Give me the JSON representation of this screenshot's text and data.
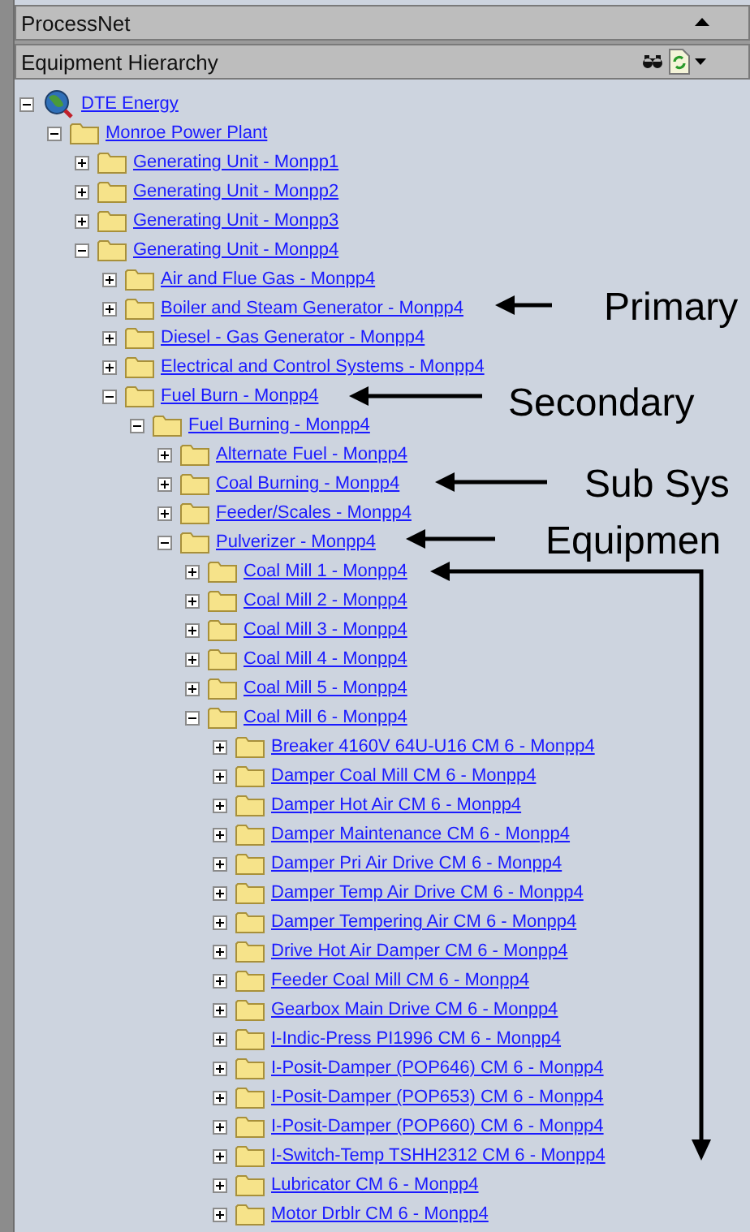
{
  "panel": {
    "title": "ProcessNet"
  },
  "section": {
    "title": "Equipment Hierarchy"
  },
  "tree": [
    {
      "label": "DTE Energy",
      "kind": "globe",
      "expanded": true,
      "children": [
        {
          "label": "Monroe Power Plant",
          "kind": "folder",
          "expanded": true,
          "children": [
            {
              "label": "Generating Unit - Monpp1",
              "kind": "folder",
              "expanded": false
            },
            {
              "label": "Generating Unit - Monpp2",
              "kind": "folder",
              "expanded": false
            },
            {
              "label": "Generating Unit - Monpp3",
              "kind": "folder",
              "expanded": false
            },
            {
              "label": "Generating Unit - Monpp4",
              "kind": "folder",
              "expanded": true,
              "children": [
                {
                  "label": "Air and Flue Gas - Monpp4",
                  "kind": "folder",
                  "expanded": false
                },
                {
                  "label": "Boiler and Steam Generator - Monpp4",
                  "kind": "folder",
                  "expanded": false
                },
                {
                  "label": "Diesel - Gas Generator - Monpp4",
                  "kind": "folder",
                  "expanded": false
                },
                {
                  "label": "Electrical and Control Systems - Monpp4",
                  "kind": "folder",
                  "expanded": false
                },
                {
                  "label": "Fuel Burn - Monpp4",
                  "kind": "folder",
                  "expanded": true,
                  "children": [
                    {
                      "label": "Fuel Burning - Monpp4",
                      "kind": "folder",
                      "expanded": true,
                      "children": [
                        {
                          "label": "Alternate Fuel - Monpp4",
                          "kind": "folder",
                          "expanded": false
                        },
                        {
                          "label": "Coal Burning - Monpp4",
                          "kind": "folder",
                          "expanded": false
                        },
                        {
                          "label": "Feeder/Scales - Monpp4",
                          "kind": "folder",
                          "expanded": false
                        },
                        {
                          "label": "Pulverizer - Monpp4",
                          "kind": "folder",
                          "expanded": true,
                          "children": [
                            {
                              "label": "Coal Mill 1 - Monpp4",
                              "kind": "folder",
                              "expanded": false
                            },
                            {
                              "label": "Coal Mill 2 - Monpp4",
                              "kind": "folder",
                              "expanded": false
                            },
                            {
                              "label": "Coal Mill 3 - Monpp4",
                              "kind": "folder",
                              "expanded": false
                            },
                            {
                              "label": "Coal Mill 4 - Monpp4",
                              "kind": "folder",
                              "expanded": false
                            },
                            {
                              "label": "Coal Mill 5 - Monpp4",
                              "kind": "folder",
                              "expanded": false
                            },
                            {
                              "label": "Coal Mill 6 - Monpp4",
                              "kind": "folder",
                              "expanded": true,
                              "children": [
                                {
                                  "label": "Breaker 4160V 64U-U16 CM 6 - Monpp4",
                                  "kind": "folder",
                                  "expanded": false
                                },
                                {
                                  "label": "Damper Coal Mill CM 6 - Monpp4",
                                  "kind": "folder",
                                  "expanded": false
                                },
                                {
                                  "label": "Damper Hot Air CM 6 - Monpp4",
                                  "kind": "folder",
                                  "expanded": false
                                },
                                {
                                  "label": "Damper Maintenance CM 6 - Monpp4",
                                  "kind": "folder",
                                  "expanded": false
                                },
                                {
                                  "label": "Damper Pri Air Drive CM 6 - Monpp4",
                                  "kind": "folder",
                                  "expanded": false
                                },
                                {
                                  "label": "Damper Temp Air Drive CM 6 - Monpp4",
                                  "kind": "folder",
                                  "expanded": false
                                },
                                {
                                  "label": "Damper Tempering Air CM 6 - Monpp4",
                                  "kind": "folder",
                                  "expanded": false
                                },
                                {
                                  "label": "Drive Hot Air Damper CM 6 - Monpp4",
                                  "kind": "folder",
                                  "expanded": false
                                },
                                {
                                  "label": "Feeder Coal Mill CM 6 - Monpp4",
                                  "kind": "folder",
                                  "expanded": false
                                },
                                {
                                  "label": "Gearbox Main Drive CM 6 - Monpp4",
                                  "kind": "folder",
                                  "expanded": false
                                },
                                {
                                  "label": "I-Indic-Press PI1996 CM 6 - Monpp4",
                                  "kind": "folder",
                                  "expanded": false
                                },
                                {
                                  "label": "I-Posit-Damper (POP646) CM 6 - Monpp4",
                                  "kind": "folder",
                                  "expanded": false
                                },
                                {
                                  "label": "I-Posit-Damper (POP653) CM 6 - Monpp4",
                                  "kind": "folder",
                                  "expanded": false
                                },
                                {
                                  "label": "I-Posit-Damper (POP660) CM 6 - Monpp4",
                                  "kind": "folder",
                                  "expanded": false
                                },
                                {
                                  "label": "I-Switch-Temp TSHH2312 CM 6 - Monpp4",
                                  "kind": "folder",
                                  "expanded": false
                                },
                                {
                                  "label": "Lubricator CM 6 - Monpp4",
                                  "kind": "folder",
                                  "expanded": false
                                },
                                {
                                  "label": "Motor Drblr CM 6 - Monpp4",
                                  "kind": "folder",
                                  "expanded": false
                                }
                              ]
                            }
                          ]
                        }
                      ]
                    }
                  ]
                }
              ]
            }
          ]
        }
      ]
    }
  ],
  "annotations": [
    {
      "label": "Primary"
    },
    {
      "label": "Secondary"
    },
    {
      "label": "Sub Sys"
    },
    {
      "label": "Equipmen"
    }
  ]
}
